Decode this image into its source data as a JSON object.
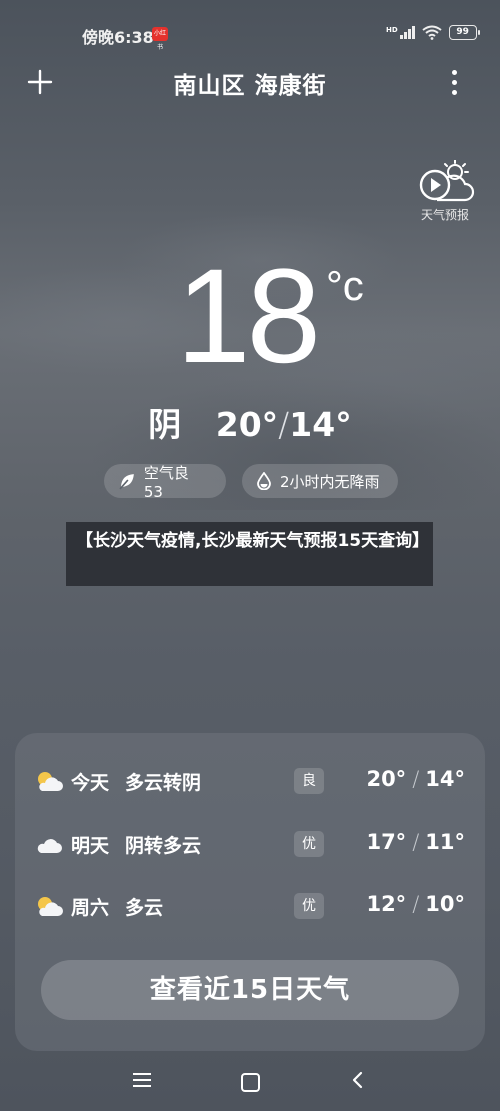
{
  "status_bar": {
    "time": "傍晚6:38",
    "app_badge": "小红书",
    "network": "HD",
    "battery": "99"
  },
  "header": {
    "title": "南山区 海康街"
  },
  "video_forecast": {
    "label": "天气预报"
  },
  "current": {
    "temperature": "18",
    "unit": "°c",
    "condition": "阴",
    "high": "20°",
    "low": "14°"
  },
  "chips": {
    "air_quality": "空气良 53",
    "rain": "2小时内无降雨"
  },
  "banner": {
    "text": "【长沙天气疫情,长沙最新天气预报15天查询】"
  },
  "forecast": [
    {
      "day": "今天",
      "condition": "多云转阴",
      "aqi": "良",
      "high": "20°",
      "low": "14°",
      "icon": "partly-cloudy-icon"
    },
    {
      "day": "明天",
      "condition": "阴转多云",
      "aqi": "优",
      "high": "17°",
      "low": "11°",
      "icon": "cloud-icon"
    },
    {
      "day": "周六",
      "condition": "多云",
      "aqi": "优",
      "high": "12°",
      "low": "10°",
      "icon": "partly-cloudy-icon"
    }
  ],
  "forecast_button": "查看近15日天气",
  "forecast_separator": "/",
  "colors": {
    "background": "#585e67",
    "banner": "#2f3238",
    "card": "#6c7179",
    "badge_red": "#e5322d"
  }
}
